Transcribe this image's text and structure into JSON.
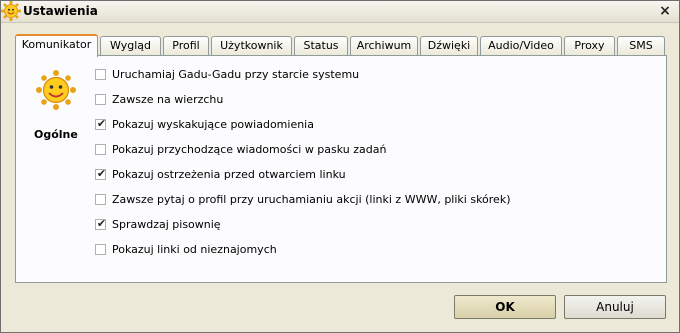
{
  "window": {
    "title": "Ustawienia"
  },
  "tabs": [
    {
      "label": "Komunikator",
      "active": true
    },
    {
      "label": "Wygląd",
      "active": false
    },
    {
      "label": "Profil",
      "active": false
    },
    {
      "label": "Użytkownik",
      "active": false
    },
    {
      "label": "Status",
      "active": false
    },
    {
      "label": "Archiwum",
      "active": false
    },
    {
      "label": "Dźwięki",
      "active": false
    },
    {
      "label": "Audio/Video",
      "active": false
    },
    {
      "label": "Proxy",
      "active": false
    },
    {
      "label": "SMS",
      "active": false
    }
  ],
  "section": {
    "label": "Ogólne",
    "icon": "sun-smiley-icon"
  },
  "options": [
    {
      "label": "Uruchamiaj Gadu-Gadu przy starcie systemu",
      "checked": false
    },
    {
      "label": "Zawsze na wierzchu",
      "checked": false
    },
    {
      "label": "Pokazuj wyskakujące powiadomienia",
      "checked": true
    },
    {
      "label": "Pokazuj przychodzące wiadomości w pasku zadań",
      "checked": false
    },
    {
      "label": "Pokazuj ostrzeżenia przed otwarciem linku",
      "checked": true
    },
    {
      "label": "Zawsze pytaj o profil przy uruchamianiu akcji (linki z WWW, pliki skórek)",
      "checked": false
    },
    {
      "label": "Sprawdzaj pisownię",
      "checked": true
    },
    {
      "label": "Pokazuj linki od nieznajomych",
      "checked": false
    }
  ],
  "buttons": {
    "ok": "OK",
    "cancel": "Anuluj"
  },
  "colors": {
    "active_tab_accent": "#e68b2c",
    "window_bg": "#ece9d8",
    "panel_bg": "#fcfcfe"
  }
}
